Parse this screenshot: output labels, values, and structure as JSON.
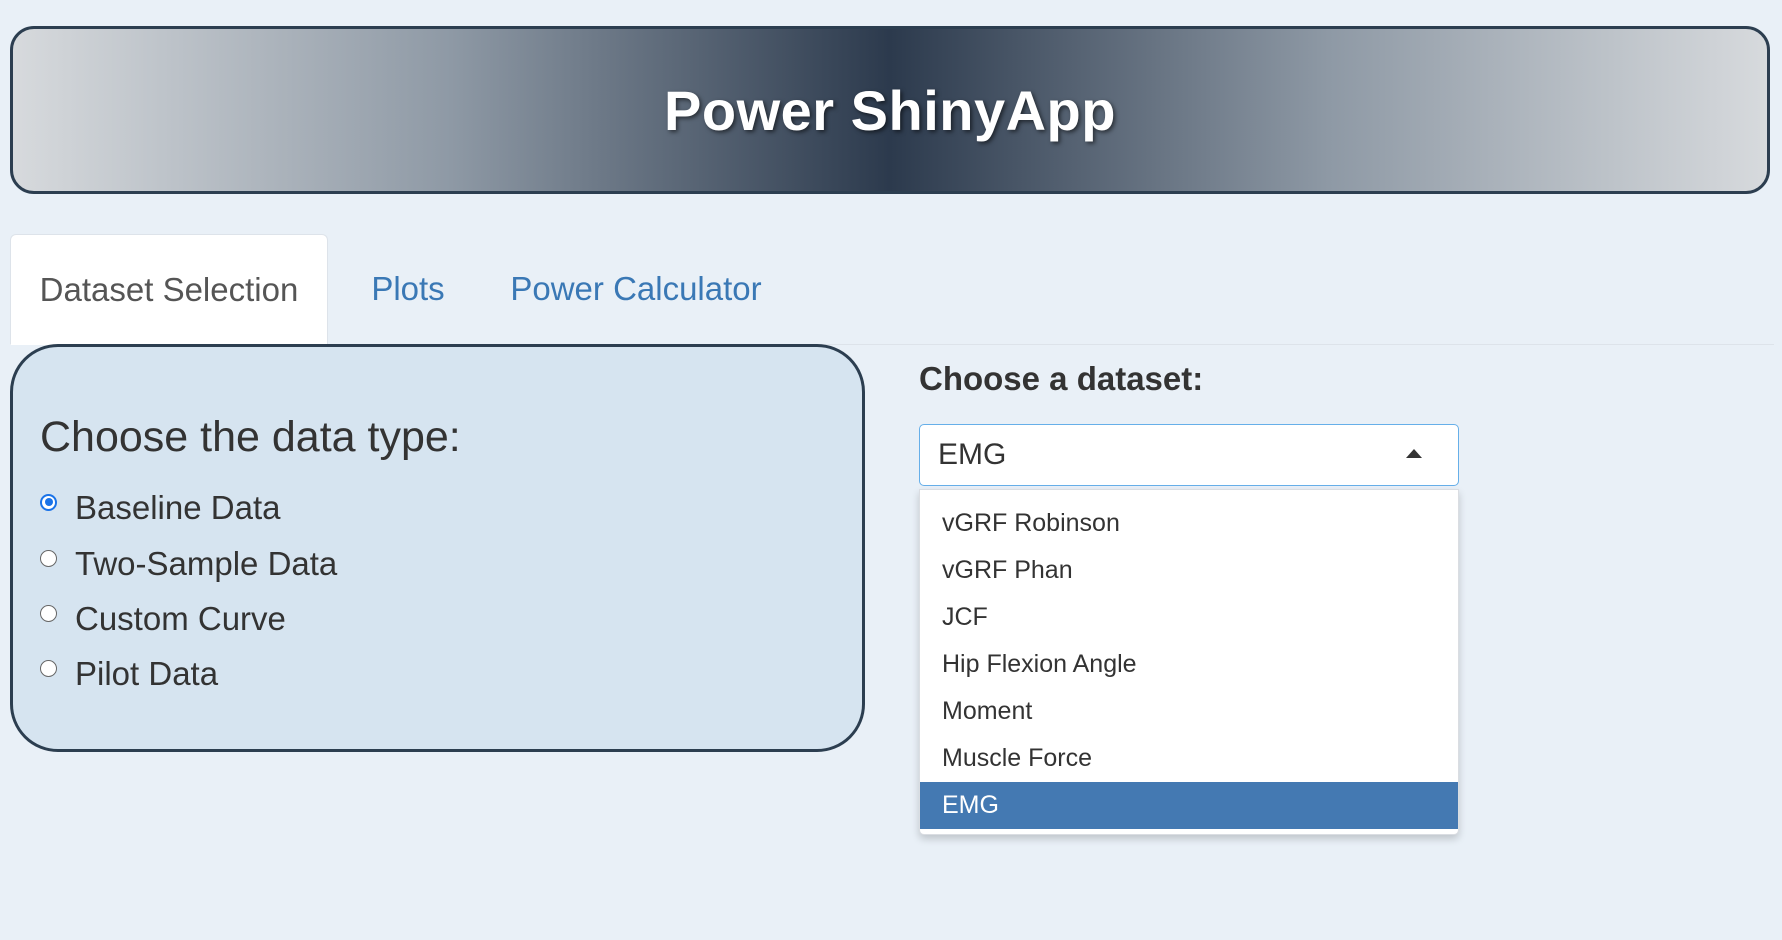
{
  "header": {
    "title": "Power ShinyApp"
  },
  "tabs": [
    {
      "label": "Dataset Selection",
      "active": true
    },
    {
      "label": "Plots",
      "active": false
    },
    {
      "label": "Power Calculator",
      "active": false
    }
  ],
  "data_type": {
    "heading": "Choose the data type:",
    "options": [
      {
        "label": "Baseline Data",
        "checked": true
      },
      {
        "label": "Two-Sample Data",
        "checked": false
      },
      {
        "label": "Custom Curve",
        "checked": false
      },
      {
        "label": "Pilot Data",
        "checked": false
      }
    ]
  },
  "dataset": {
    "label": "Choose a dataset:",
    "selected": "EMG",
    "options": [
      "vGRF Robinson",
      "vGRF Phan",
      "JCF",
      "Hip Flexion Angle",
      "Moment",
      "Muscle Force",
      "EMG"
    ]
  },
  "colors": {
    "background": "#e9f0f7",
    "banner_center": "#2c3a4d",
    "tab_link": "#3a78b5",
    "card_bg": "#d6e4f0",
    "selected_option": "#4479b2",
    "radio_checked": "#1a73e8"
  }
}
